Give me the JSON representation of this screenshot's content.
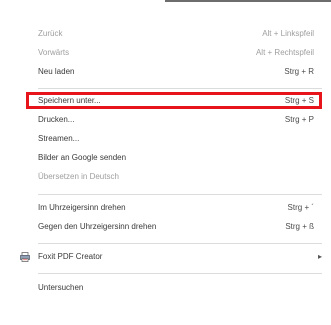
{
  "context_menu": {
    "items": [
      {
        "label": "Zurück",
        "shortcut": "Alt + Linkspfeil"
      },
      {
        "label": "Vorwärts",
        "shortcut": "Alt + Rechtspfeil"
      },
      {
        "label": "Neu laden",
        "shortcut": "Strg + R"
      },
      {
        "label": "Speichern unter...",
        "shortcut": "Strg + S"
      },
      {
        "label": "Drucken...",
        "shortcut": "Strg + P"
      },
      {
        "label": "Streamen..."
      },
      {
        "label": "Bilder an Google senden"
      },
      {
        "label": "Übersetzen in Deutsch"
      },
      {
        "label": "Im Uhrzeigersinn drehen",
        "shortcut": "Strg + ´"
      },
      {
        "label": "Gegen den Uhrzeigersinn drehen",
        "shortcut": "Strg + ß"
      },
      {
        "label": "Foxit PDF Creator",
        "icon": "pdf-printer-icon",
        "submenu_arrow": "▸"
      },
      {
        "label": "Untersuchen"
      }
    ]
  },
  "colors": {
    "highlight_border": "#e8141b",
    "disabled_text": "#9e9e9e",
    "separator": "#dcdcdc"
  }
}
